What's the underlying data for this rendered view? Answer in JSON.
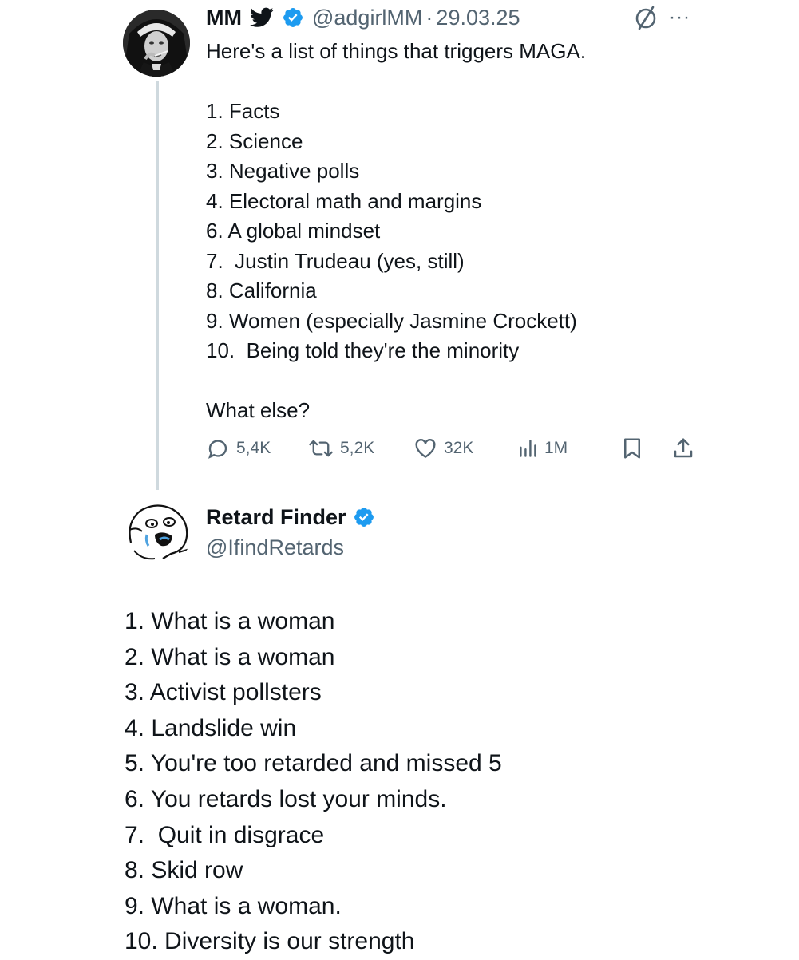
{
  "tweet1": {
    "author_name": "MM",
    "handle": "@adgirlMM",
    "separator": "·",
    "date": "29.03.25",
    "more_label": "···",
    "intro": "Here's a list of things that triggers MAGA.",
    "list": [
      "1. Facts",
      "2. Science",
      "3. Negative polls",
      "4. Electoral math and margins",
      "6. A global mindset",
      "7.  Justin Trudeau (yes, still)",
      "8. California",
      "9. Women (especially Jasmine Crockett)",
      "10.  Being told they're the minority"
    ],
    "closing": "What else?",
    "actions": {
      "replies": "5,4K",
      "reposts": "5,2K",
      "likes": "32K",
      "views": "1M"
    }
  },
  "tweet2": {
    "author_name": "Retard Finder",
    "handle": "@IfindRetards",
    "list": [
      "1. What is a woman",
      "2. What is a woman",
      "3. Activist pollsters",
      "4. Landslide win",
      "5. You're too retarded and missed 5",
      "6. You retards lost your minds.",
      "7.  Quit in disgrace",
      "8. Skid row",
      "9. What is a woman.",
      "10. Diversity is our strength"
    ]
  },
  "colors": {
    "text": "#0f1419",
    "secondary": "#536471",
    "verified": "#1d9bf0",
    "thread_line": "#cfd9de"
  },
  "icons": {
    "bird": "bird-icon",
    "verified": "verified-badge-icon",
    "grok": "circle-slash-icon",
    "reply": "speech-bubble-icon",
    "repost": "repost-arrows-icon",
    "like": "heart-icon",
    "views": "bar-chart-icon",
    "bookmark": "bookmark-icon",
    "share": "share-upload-icon"
  }
}
